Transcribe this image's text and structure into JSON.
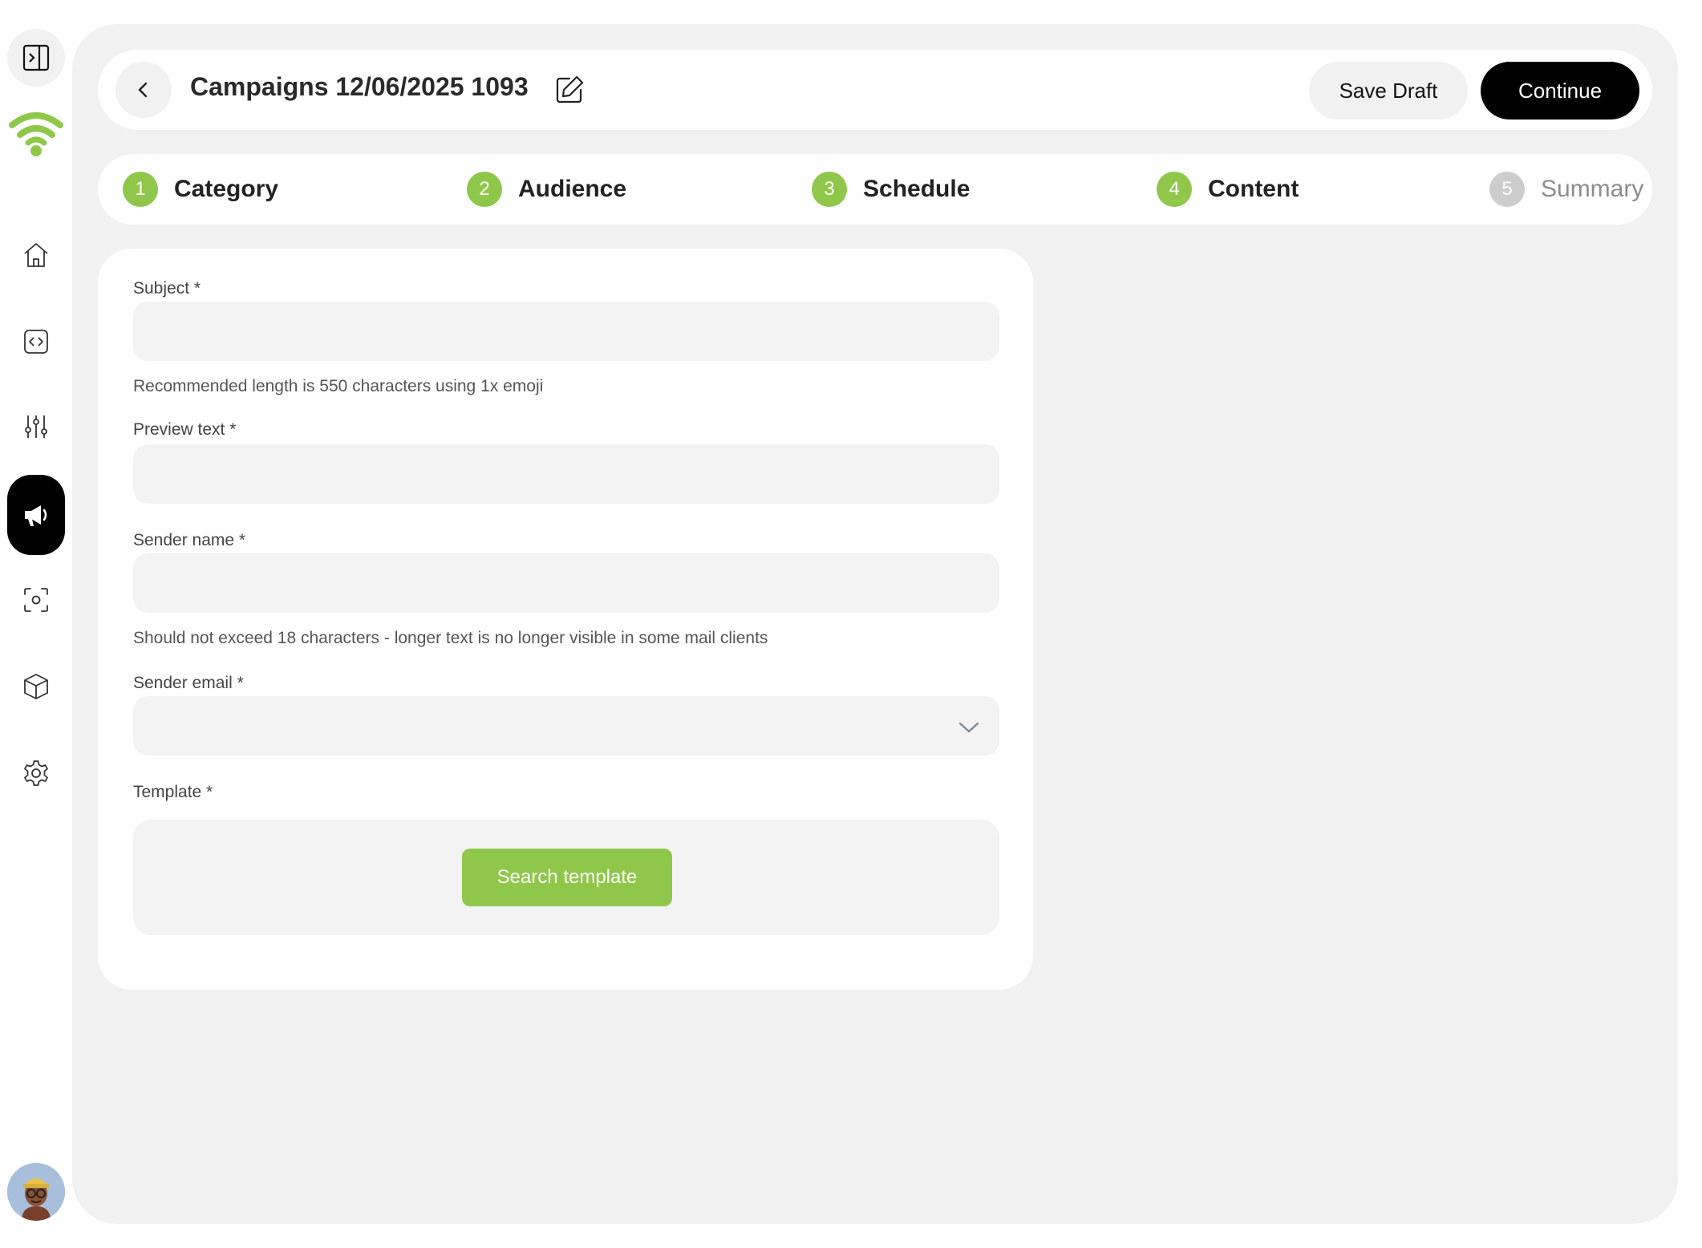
{
  "sidebar": {
    "toggle_icon": "sidebar-toggle-icon",
    "logo_icon": "wifi-logo-icon",
    "brand_color": "#8fc74a",
    "items": [
      {
        "name": "home",
        "icon": "home-icon",
        "active": false
      },
      {
        "name": "code",
        "icon": "code-icon",
        "active": false
      },
      {
        "name": "filters",
        "icon": "sliders-icon",
        "active": false
      },
      {
        "name": "campaigns",
        "icon": "megaphone-icon",
        "active": true
      },
      {
        "name": "scan",
        "icon": "scan-icon",
        "active": false
      },
      {
        "name": "products",
        "icon": "box-icon",
        "active": false
      },
      {
        "name": "settings",
        "icon": "gear-icon",
        "active": false
      }
    ],
    "avatar_icon": "user-avatar"
  },
  "header": {
    "title": "Campaigns 12/06/2025 1093",
    "save_draft_label": "Save Draft",
    "continue_label": "Continue"
  },
  "stepper": {
    "steps": [
      {
        "number": "1",
        "label": "Category",
        "state": "done"
      },
      {
        "number": "2",
        "label": "Audience",
        "state": "done"
      },
      {
        "number": "3",
        "label": "Schedule",
        "state": "done"
      },
      {
        "number": "4",
        "label": "Content",
        "state": "current"
      },
      {
        "number": "5",
        "label": "Summary",
        "state": "upcoming"
      }
    ]
  },
  "form": {
    "subject": {
      "label": "Subject *",
      "value": "",
      "hint": "Recommended length is 550 characters using 1x emoji"
    },
    "preview_text": {
      "label": "Preview text *",
      "value": ""
    },
    "sender_name": {
      "label": "Sender name *",
      "value": "",
      "hint": "Should not exceed 18 characters - longer text is no longer visible in some mail clients"
    },
    "sender_email": {
      "label": "Sender email *",
      "value": ""
    },
    "template": {
      "label": "Template *",
      "button_label": "Search template"
    }
  },
  "colors": {
    "accent": "#8fc74a",
    "primary_button": "#000000",
    "panel_bg": "#f1f1f1",
    "inactive_step": "#cdcdcd"
  }
}
